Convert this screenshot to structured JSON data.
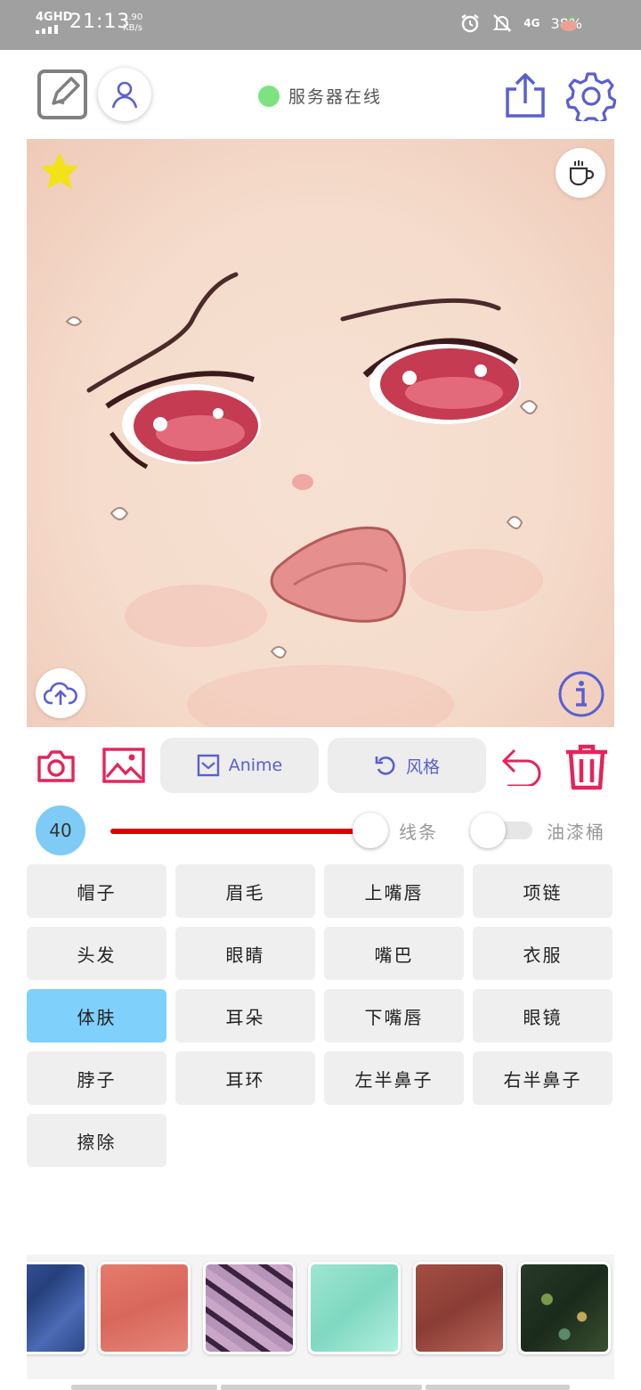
{
  "status_bar": {
    "network": "4GHD",
    "time": "21:13",
    "speed_value": "1.90",
    "speed_unit": "KB/s",
    "cell_signal": "4G",
    "battery": "38%",
    "icons": [
      "alarm-icon",
      "mute-icon",
      "peach-icon"
    ]
  },
  "toolbar": {
    "server_status": "服务器在线",
    "server_status_color": "#7ee27e",
    "icon_color": "#5a5fd0"
  },
  "canvas": {
    "icons": [
      "star-icon",
      "coffee-cup-icon",
      "cloud-upload-icon",
      "info-icon"
    ]
  },
  "actions": {
    "anime_label": "Anime",
    "style_label": "风格",
    "accent_color": "#e5245a"
  },
  "slider": {
    "size_value": "40",
    "line_label": "线条",
    "bucket_label": "油漆桶",
    "bucket_enabled": false,
    "track_color": "#e00000",
    "level": 1.0
  },
  "parts": [
    {
      "label": "帽子",
      "active": false
    },
    {
      "label": "眉毛",
      "active": false
    },
    {
      "label": "上嘴唇",
      "active": false
    },
    {
      "label": "项链",
      "active": false
    },
    {
      "label": "头发",
      "active": false
    },
    {
      "label": "眼睛",
      "active": false
    },
    {
      "label": "嘴巴",
      "active": false
    },
    {
      "label": "衣服",
      "active": false
    },
    {
      "label": "体肤",
      "active": true
    },
    {
      "label": "耳朵",
      "active": false
    },
    {
      "label": "下嘴唇",
      "active": false
    },
    {
      "label": "眼镜",
      "active": false
    },
    {
      "label": "脖子",
      "active": false
    },
    {
      "label": "耳环",
      "active": false
    },
    {
      "label": "左半鼻子",
      "active": false
    },
    {
      "label": "右半鼻子",
      "active": false
    },
    {
      "label": "擦除",
      "active": false
    }
  ],
  "textures": [
    "blue",
    "coral",
    "purple-stripe",
    "mint",
    "brown",
    "dark-glitter"
  ]
}
